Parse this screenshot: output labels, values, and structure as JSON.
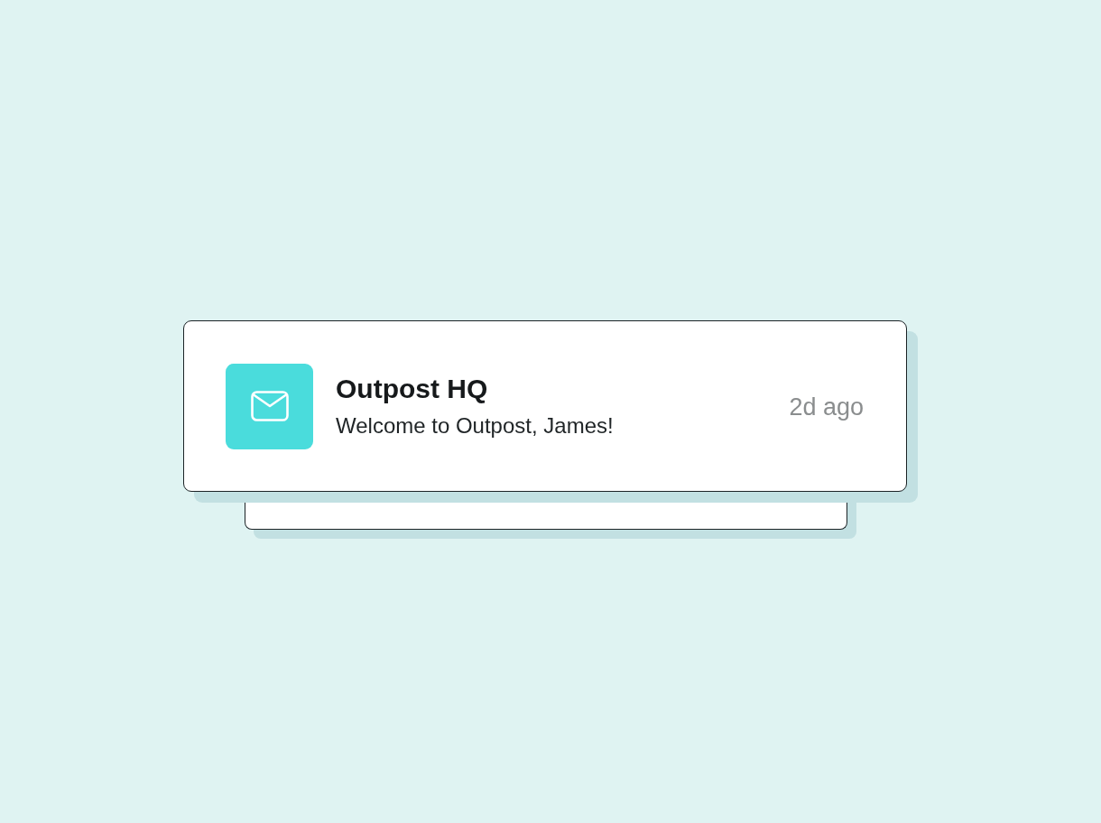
{
  "notification": {
    "sender": "Outpost HQ",
    "message": "Welcome to Outpost, James!",
    "time": "2d ago"
  }
}
